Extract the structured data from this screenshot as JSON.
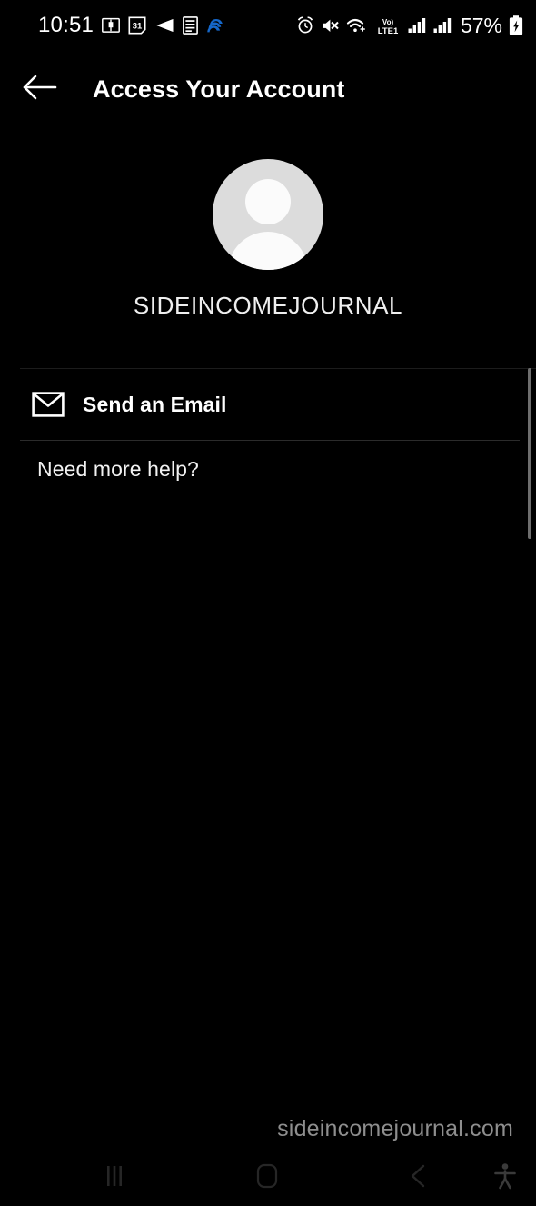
{
  "status_bar": {
    "time": "10:51",
    "battery_percent": "57%",
    "left_icons": [
      {
        "name": "book-notification-icon",
        "glyph": "book"
      },
      {
        "name": "calendar-31-icon",
        "glyph": "calendar",
        "day": "31"
      },
      {
        "name": "rewind-notification-icon",
        "glyph": "rewind"
      },
      {
        "name": "document-notification-icon",
        "glyph": "document"
      },
      {
        "name": "cloud-app-icon",
        "glyph": "blue-cloud",
        "color": "#1567c9"
      }
    ],
    "right_icons": [
      {
        "name": "alarm-icon",
        "glyph": "alarm"
      },
      {
        "name": "mute-icon",
        "glyph": "speaker-muted"
      },
      {
        "name": "wifi-icon",
        "glyph": "wifi"
      },
      {
        "name": "volte-lte1-icon",
        "glyph": "VoLTE1",
        "label_top": "Vo)",
        "label_bottom": "LTE1"
      },
      {
        "name": "signal-bars-sim1-icon",
        "glyph": "signal"
      },
      {
        "name": "signal-bars-sim2-icon",
        "glyph": "signal"
      },
      {
        "name": "battery-icon",
        "glyph": "battery-charging"
      }
    ]
  },
  "header": {
    "back_label": "Back",
    "title": "Access Your Account"
  },
  "profile": {
    "avatar_name": "default-avatar",
    "avatar_bg_color": "#dcdcdc",
    "avatar_fg_color": "#fbfbfb",
    "username": "SIDEINCOMEJOURNAL"
  },
  "options": {
    "email": {
      "icon_name": "envelope-icon",
      "label": "Send an Email"
    },
    "help": {
      "label": "Need more help?"
    }
  },
  "watermark": {
    "text": "sideincomejournal.com",
    "color": "#8e8e8e"
  },
  "scrollbar": {
    "name": "page-scrollbar",
    "color": "#6e6e6e"
  },
  "nav_bar": {
    "recents_label": "Recents",
    "home_label": "Home",
    "back_label": "Back",
    "accessibility_label": "Accessibility",
    "icon_color": "#262626"
  }
}
